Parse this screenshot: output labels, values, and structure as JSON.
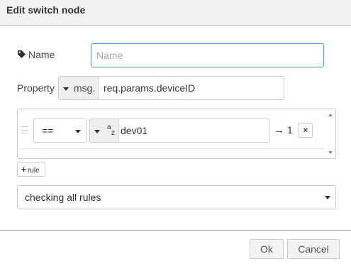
{
  "dialog": {
    "title": "Edit switch node"
  },
  "name_field": {
    "label": "Name",
    "placeholder": "Name",
    "value": "",
    "icon": "tag-icon"
  },
  "property_field": {
    "label": "Property",
    "type_prefix": "msg.",
    "value": "req.params.deviceID"
  },
  "rules": [
    {
      "operator": "==",
      "value_type_icon": "string-az-icon",
      "value_type_a": "a",
      "value_type_z": "z",
      "value": "dev01",
      "output_arrow": "→",
      "output": "1",
      "remove_label": "×"
    }
  ],
  "add_rule": {
    "plus": "+",
    "label": "rule"
  },
  "checking_mode": {
    "value": "checking all rules"
  },
  "footer": {
    "ok_label": "Ok",
    "cancel_label": "Cancel"
  },
  "colors": {
    "title_bg": "#f3f3f3",
    "focus_border": "#5b9bd5",
    "border": "#cccccc",
    "type_bg": "#efefef"
  }
}
